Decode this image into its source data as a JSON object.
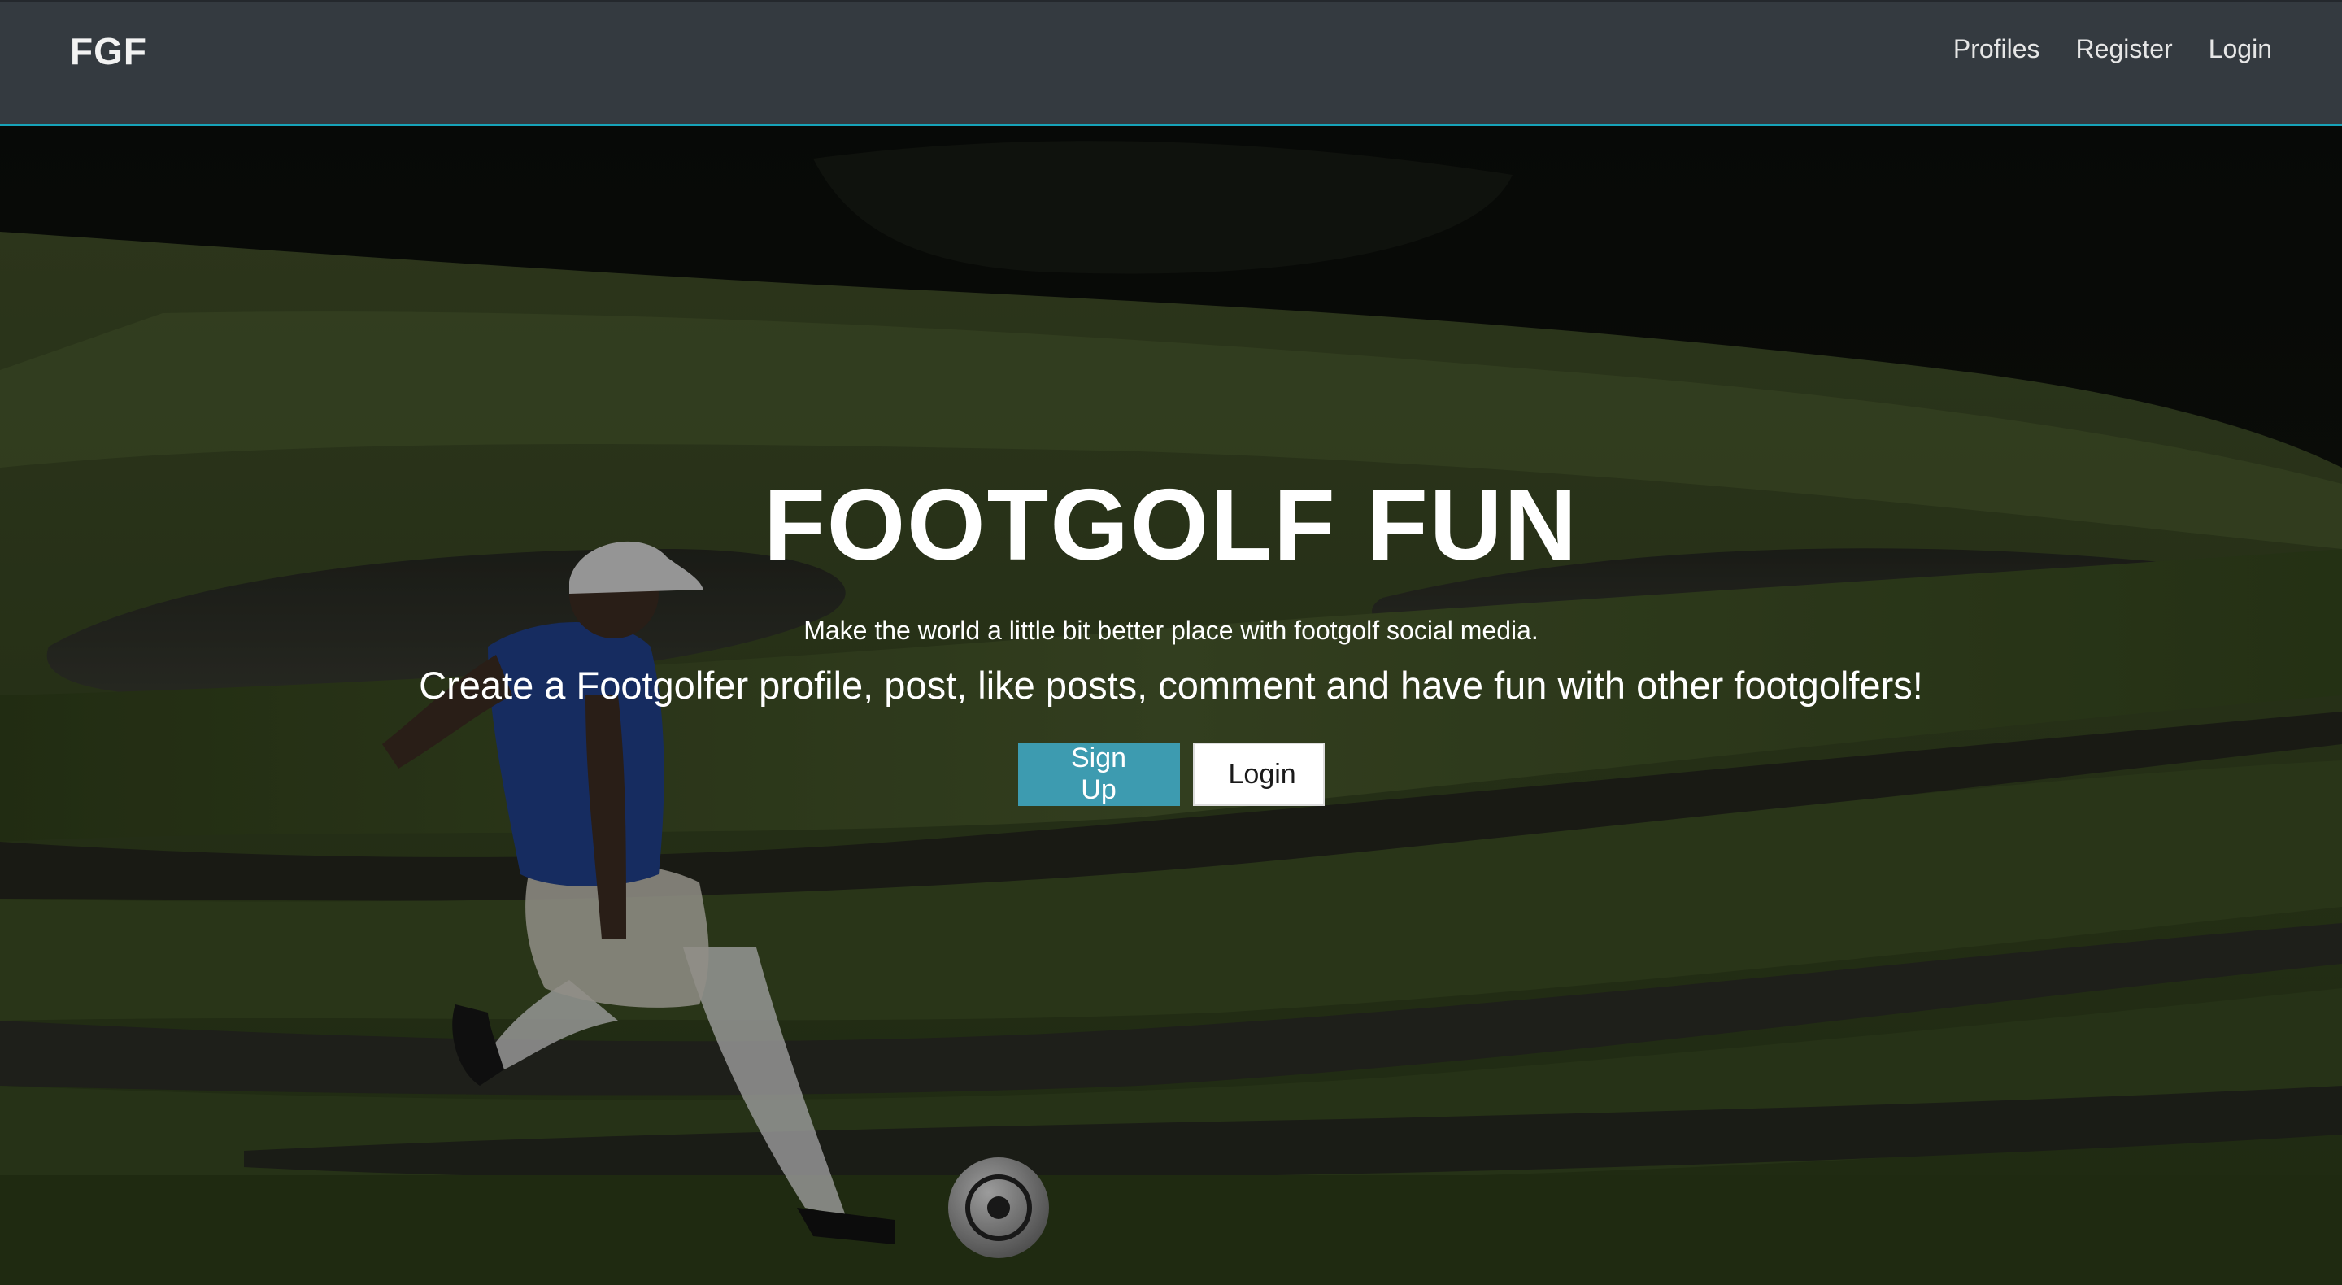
{
  "navbar": {
    "brand": "FGF",
    "links": [
      {
        "label": "Profiles"
      },
      {
        "label": "Register"
      },
      {
        "label": "Login"
      }
    ],
    "accent_color": "#17a2b8",
    "background_color": "#343a40"
  },
  "hero": {
    "title": "FOOTGOLF FUN",
    "subtitle": "Make the world a little bit better place with footgolf social media.",
    "tagline": "Create a Footgolfer profile, post, like posts, comment and have fun with other footgolfers!",
    "buttons": {
      "signup_label": "Sign Up",
      "login_label": "Login"
    },
    "signup_color": "#3d9bb0"
  }
}
